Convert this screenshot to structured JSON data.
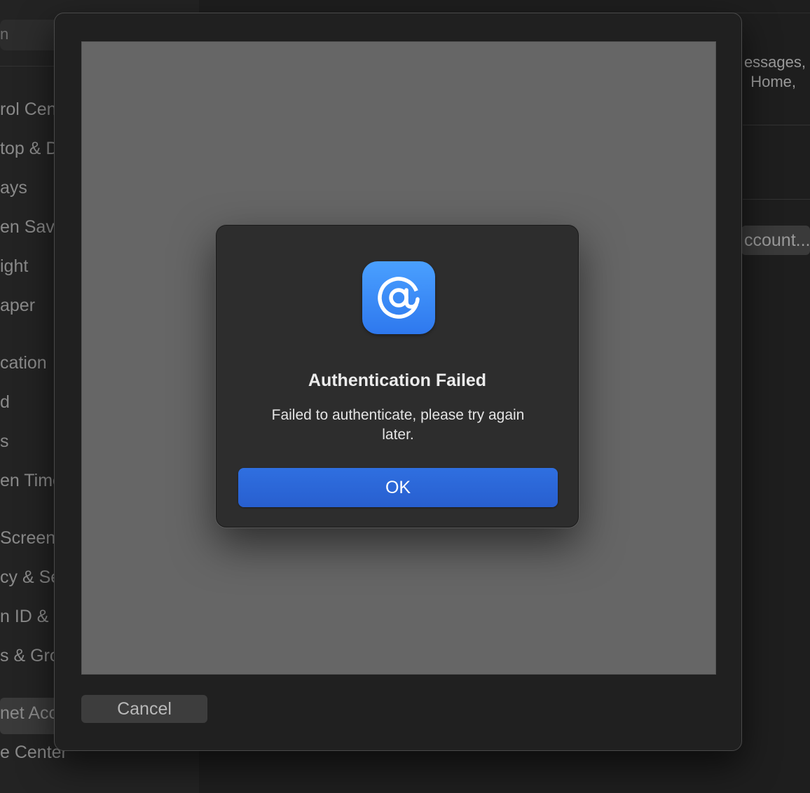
{
  "background": {
    "search_text": "n",
    "sidebar_items": [
      {
        "label": "rol Cen"
      },
      {
        "label": "top & D"
      },
      {
        "label": "ays"
      },
      {
        "label": "en Save"
      },
      {
        "label": "ight"
      },
      {
        "label": "aper"
      },
      {
        "label": "cation"
      },
      {
        "label": "d"
      },
      {
        "label": "s"
      },
      {
        "label": "en Time"
      },
      {
        "label": "Screen"
      },
      {
        "label": "cy & Se"
      },
      {
        "label": "n ID & "
      },
      {
        "label": "s & Gro"
      },
      {
        "label": "net Acc"
      },
      {
        "label": "e Center"
      }
    ],
    "right_text_line1": "essages,",
    "right_text_line2": "Home,",
    "add_account_label": "ccount..."
  },
  "sheet": {
    "cancel_label": "Cancel"
  },
  "alert": {
    "icon": "at-sign-icon",
    "title": "Authentication Failed",
    "message": "Failed to authenticate, please try again later.",
    "ok_label": "OK"
  },
  "colors": {
    "accent": "#2f6fe0",
    "icon_gradient_top": "#4aa0ff",
    "icon_gradient_bottom": "#2e78ee"
  }
}
